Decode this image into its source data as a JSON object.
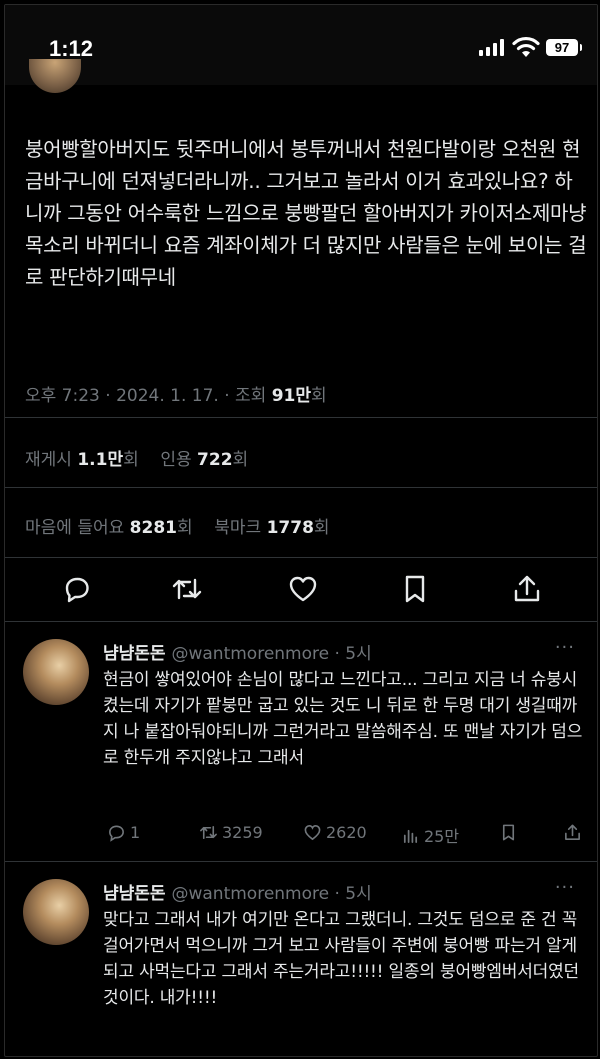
{
  "status_bar": {
    "time": "1:12",
    "battery": "97"
  },
  "tweet": {
    "text": "붕어빵할아버지도 뒷주머니에서 봉투꺼내서 천원다발이랑 오천원 현금바구니에 던져넣더라니까.. 그거보고 놀라서 이거 효과있나요? 하니까 그동안 어수룩한 느낌으로 붕빵팔던 할아버지가 카이저소제마냥 목소리 바뀌더니 요즘 계좌이체가 더 많지만 사람들은 눈에 보이는 걸로 판단하기때무네",
    "meta_prefix": "오후 7:23 · 2024. 1. 17. · 조회 ",
    "views": "91만",
    "views_suffix": "회",
    "reposts_label": "재게시 ",
    "reposts": "1.1만",
    "reposts_suffix": "회",
    "quotes_label": "인용 ",
    "quotes": "722",
    "quotes_suffix": "회",
    "likes_label": "마음에 들어요 ",
    "likes": "8281",
    "likes_suffix": "회",
    "bookmarks_label": "북마크 ",
    "bookmarks": "1778",
    "bookmarks_suffix": "회"
  },
  "replies": [
    {
      "name": "냠냠돈돈",
      "handle": "@wantmorenmore · 5시",
      "text": "현금이 쌓여있어야 손님이 많다고 느낀다고... 그리고 지금 너 슈붕시켰는데 자기가 팥붕만 굽고 있는 것도 니 뒤로 한 두명 대기 생길때까지 나 붙잡아둬야되니까 그런거라고 말씀해주심. 또 맨날 자기가 덤으로 한두개 주지않냐고 그래서",
      "replies": "1",
      "reposts": "3259",
      "likes": "2620",
      "views": "25만"
    },
    {
      "name": "냠냠돈돈",
      "handle": "@wantmorenmore · 5시",
      "text": "맞다고 그래서 내가 여기만 온다고 그랬더니. 그것도 덤으로 준 건 꼭 걸어가면서 먹으니까 그거 보고 사람들이 주변에 붕어빵 파는거 알게되고 사먹는다고 그래서 주는거라고!!!!! 일종의 붕어빵엠버서더였던것이다. 내가!!!!"
    }
  ]
}
